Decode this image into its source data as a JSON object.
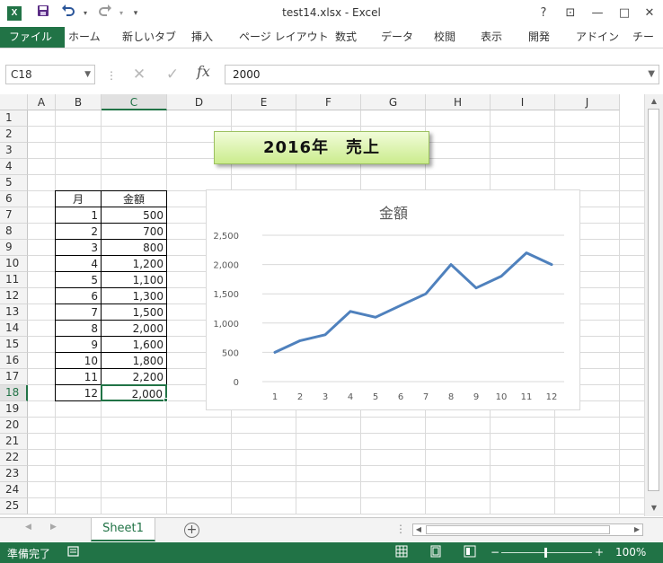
{
  "window": {
    "title": "test14.xlsx - Excel",
    "app_logo": "X",
    "help": "?",
    "ribbon_display": "⊡",
    "minimize": "—",
    "maximize": "□",
    "close": "✕"
  },
  "quick_access": {
    "save_icon": "save-icon",
    "undo_icon": "undo-icon",
    "redo_icon": "redo-icon",
    "customize_icon": "customize-icon"
  },
  "ribbon": {
    "tabs": [
      "ファイル",
      "ホーム",
      "新しいタブ",
      "挿入",
      "ページ レイアウト",
      "数式",
      "データ",
      "校閲",
      "表示",
      "開発",
      "アドイン",
      "チー"
    ]
  },
  "formula_bar": {
    "name_box": "C18",
    "formula": "2000"
  },
  "grid": {
    "columns": [
      "A",
      "B",
      "C",
      "D",
      "E",
      "F",
      "G",
      "H",
      "I",
      "J"
    ],
    "rows": [
      "1",
      "2",
      "3",
      "4",
      "5",
      "6",
      "7",
      "8",
      "9",
      "10",
      "11",
      "12",
      "13",
      "14",
      "15",
      "16",
      "17",
      "18",
      "19",
      "20",
      "21",
      "22",
      "23",
      "24",
      "25"
    ],
    "selected_cell": "C18"
  },
  "table": {
    "header_month": "月",
    "header_amount": "金額",
    "months": [
      "1",
      "2",
      "3",
      "4",
      "5",
      "6",
      "7",
      "8",
      "9",
      "10",
      "11",
      "12"
    ],
    "amounts": [
      "500",
      "700",
      "800",
      "1,200",
      "1,100",
      "1,300",
      "1,500",
      "2,000",
      "1,600",
      "1,800",
      "2,200",
      "2,000"
    ]
  },
  "banner": {
    "text": "2016年　売上"
  },
  "chart_data": {
    "type": "line",
    "title": "金額",
    "categories": [
      "1",
      "2",
      "3",
      "4",
      "5",
      "6",
      "7",
      "8",
      "9",
      "10",
      "11",
      "12"
    ],
    "values": [
      500,
      700,
      800,
      1200,
      1100,
      1300,
      1500,
      2000,
      1600,
      1800,
      2200,
      2000
    ],
    "y_ticks": [
      "0",
      "500",
      "1,000",
      "1,500",
      "2,000",
      "2,500"
    ],
    "ylim": [
      0,
      2500
    ],
    "grid": true,
    "line_color": "#4f81bd"
  },
  "sheets": {
    "tabs": [
      "Sheet1"
    ],
    "add_label": "+",
    "nav_prev": "◀",
    "nav_next": "▶",
    "dots": "⋮"
  },
  "status": {
    "text": "準備完了",
    "zoom": "100%",
    "zoom_minus": "−",
    "zoom_plus": "+"
  },
  "colors": {
    "accent": "#217346"
  }
}
